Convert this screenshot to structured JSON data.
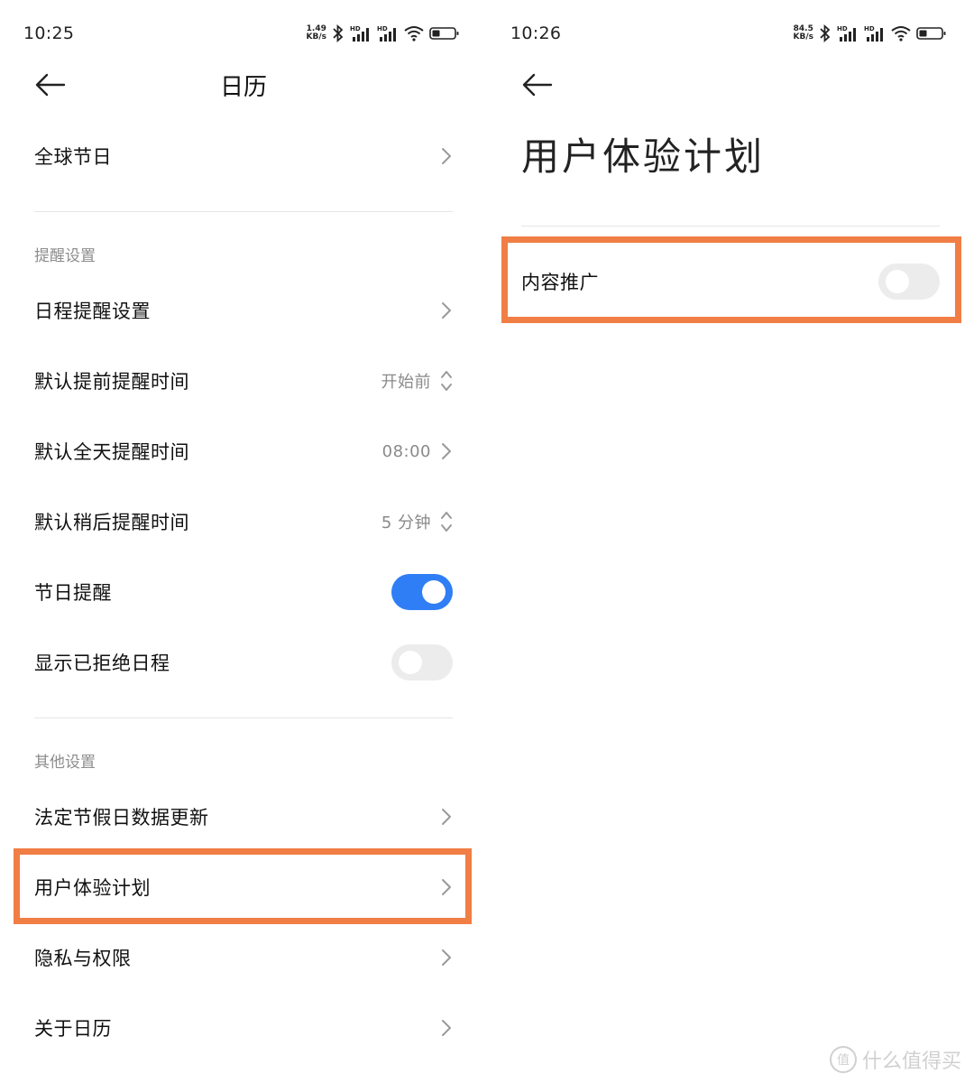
{
  "left": {
    "status": {
      "time": "10:25",
      "net_value": "1.49",
      "net_unit": "KB/s",
      "hd": "HD"
    },
    "title": "日历",
    "global_holidays": "全球节日",
    "section_reminder": "提醒设置",
    "reminder_items": [
      {
        "label": "日程提醒设置"
      },
      {
        "label": "默认提前提醒时间",
        "value": "开始前"
      },
      {
        "label": "默认全天提醒时间",
        "value": "08:00"
      },
      {
        "label": "默认稍后提醒时间",
        "value": "5 分钟"
      }
    ],
    "toggle_items": [
      {
        "label": "节日提醒",
        "state": "on"
      },
      {
        "label": "显示已拒绝日程",
        "state": "off"
      }
    ],
    "section_other": "其他设置",
    "other_items": [
      {
        "label": "法定节假日数据更新"
      },
      {
        "label": "用户体验计划"
      },
      {
        "label": "隐私与权限"
      },
      {
        "label": "关于日历"
      }
    ]
  },
  "right": {
    "status": {
      "time": "10:26",
      "net_value": "84.5",
      "net_unit": "KB/s",
      "hd": "HD"
    },
    "title": "用户体验计划",
    "content_promo": {
      "label": "内容推广",
      "state": "off"
    }
  },
  "colors": {
    "accent_blue": "#2f7ef5",
    "highlight_orange": "#f07e45",
    "toggle_off": "#ececec"
  },
  "watermark": "什么值得买",
  "watermark_badge": "值"
}
